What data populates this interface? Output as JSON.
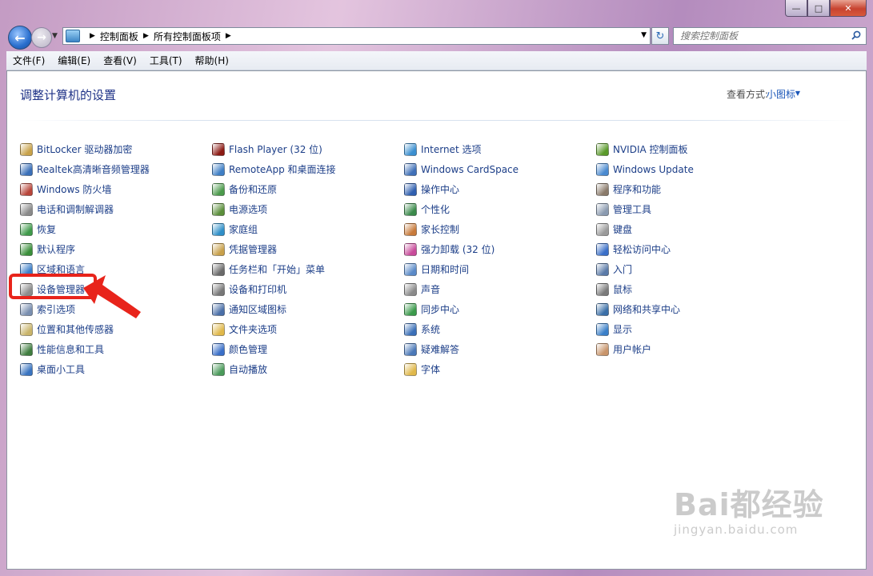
{
  "window": {
    "buttons": {
      "minimize": "—",
      "maximize": "□",
      "close": "✕"
    }
  },
  "navigation": {
    "breadcrumb": [
      "控制面板",
      "所有控制面板项"
    ],
    "search_placeholder": "搜索控制面板"
  },
  "menubar": {
    "items": [
      "文件(F)",
      "编辑(E)",
      "查看(V)",
      "工具(T)",
      "帮助(H)"
    ]
  },
  "header": {
    "title": "调整计算机的设置",
    "view_by_label": "查看方式:",
    "view_by_value": "小图标"
  },
  "columns": [
    {
      "items": [
        {
          "label": "BitLocker 驱动器加密",
          "icon": "bitlocker-icon",
          "color": "#c8a24a"
        },
        {
          "label": "Realtek高清晰音频管理器",
          "icon": "realtek-audio-icon",
          "color": "#3a6fb8"
        },
        {
          "label": "Windows 防火墙",
          "icon": "firewall-icon",
          "color": "#b8453a"
        },
        {
          "label": "电话和调制解调器",
          "icon": "phone-modem-icon",
          "color": "#8a8a8a"
        },
        {
          "label": "恢复",
          "icon": "recovery-icon",
          "color": "#3f9a4a"
        },
        {
          "label": "默认程序",
          "icon": "default-programs-icon",
          "color": "#3a8f3a"
        },
        {
          "label": "区域和语言",
          "icon": "region-language-icon",
          "color": "#3d7fc8"
        },
        {
          "label": "设备管理器",
          "icon": "device-manager-icon",
          "color": "#8c8c8c"
        },
        {
          "label": "索引选项",
          "icon": "indexing-icon",
          "color": "#7a8fb0"
        },
        {
          "label": "位置和其他传感器",
          "icon": "location-sensor-icon",
          "color": "#c9b46a"
        },
        {
          "label": "性能信息和工具",
          "icon": "performance-icon",
          "color": "#3f7d3f"
        },
        {
          "label": "桌面小工具",
          "icon": "gadgets-icon",
          "color": "#3a74c0"
        }
      ]
    },
    {
      "items": [
        {
          "label": "Flash Player (32 位)",
          "icon": "flash-player-icon",
          "color": "#8c1a14"
        },
        {
          "label": "RemoteApp 和桌面连接",
          "icon": "remoteapp-icon",
          "color": "#3f7fc5"
        },
        {
          "label": "备份和还原",
          "icon": "backup-restore-icon",
          "color": "#4b9a4b"
        },
        {
          "label": "电源选项",
          "icon": "power-options-icon",
          "color": "#5b8f3b"
        },
        {
          "label": "家庭组",
          "icon": "homegroup-icon",
          "color": "#2f8fc8"
        },
        {
          "label": "凭据管理器",
          "icon": "credential-manager-icon",
          "color": "#c8a04a"
        },
        {
          "label": "任务栏和「开始」菜单",
          "icon": "taskbar-icon",
          "color": "#6a6a6a"
        },
        {
          "label": "设备和打印机",
          "icon": "printer-icon",
          "color": "#777777"
        },
        {
          "label": "通知区域图标",
          "icon": "notification-area-icon",
          "color": "#4a6fa8"
        },
        {
          "label": "文件夹选项",
          "icon": "folder-options-icon",
          "color": "#e0b84a"
        },
        {
          "label": "颜色管理",
          "icon": "color-management-icon",
          "color": "#3a6fc8"
        },
        {
          "label": "自动播放",
          "icon": "autoplay-icon",
          "color": "#4a9a5a"
        }
      ]
    },
    {
      "items": [
        {
          "label": "Internet 选项",
          "icon": "internet-options-icon",
          "color": "#3a8fd0"
        },
        {
          "label": "Windows CardSpace",
          "icon": "cardspace-icon",
          "color": "#3f70b8"
        },
        {
          "label": "操作中心",
          "icon": "action-center-flag-icon",
          "color": "#2f5fb0"
        },
        {
          "label": "个性化",
          "icon": "personalization-icon",
          "color": "#3a8a4a"
        },
        {
          "label": "家长控制",
          "icon": "parental-controls-icon",
          "color": "#c87a3a"
        },
        {
          "label": "强力卸载 (32 位)",
          "icon": "uninstall-icon",
          "color": "#c84a9a"
        },
        {
          "label": "日期和时间",
          "icon": "date-time-icon",
          "color": "#5a8ac8"
        },
        {
          "label": "声音",
          "icon": "sound-icon",
          "color": "#8a8a8a"
        },
        {
          "label": "同步中心",
          "icon": "sync-center-icon",
          "color": "#3a9a4a"
        },
        {
          "label": "系统",
          "icon": "system-icon",
          "color": "#3a6fb8"
        },
        {
          "label": "疑难解答",
          "icon": "troubleshooting-icon",
          "color": "#4a78b8"
        },
        {
          "label": "字体",
          "icon": "fonts-icon",
          "color": "#e0b84a"
        }
      ]
    },
    {
      "items": [
        {
          "label": "NVIDIA 控制面板",
          "icon": "nvidia-icon",
          "color": "#5a9a2a"
        },
        {
          "label": "Windows Update",
          "icon": "windows-update-icon",
          "color": "#4a8ad0"
        },
        {
          "label": "程序和功能",
          "icon": "programs-features-icon",
          "color": "#8a7a6a"
        },
        {
          "label": "管理工具",
          "icon": "admin-tools-icon",
          "color": "#8a9ab0"
        },
        {
          "label": "键盘",
          "icon": "keyboard-icon",
          "color": "#9a9a9a"
        },
        {
          "label": "轻松访问中心",
          "icon": "ease-of-access-icon",
          "color": "#3a6fc8"
        },
        {
          "label": "入门",
          "icon": "getting-started-icon",
          "color": "#5a7aa8"
        },
        {
          "label": "鼠标",
          "icon": "mouse-icon",
          "color": "#7a7a7a"
        },
        {
          "label": "网络和共享中心",
          "icon": "network-sharing-icon",
          "color": "#3a6fa8"
        },
        {
          "label": "显示",
          "icon": "display-icon",
          "color": "#3a7fc8"
        },
        {
          "label": "用户帐户",
          "icon": "user-accounts-icon",
          "color": "#c8946a"
        }
      ]
    }
  ],
  "annotation": {
    "highlight_color": "#e8241b"
  },
  "watermark": {
    "brand": "Bai都经验",
    "url": "jingyan.baidu.com"
  }
}
